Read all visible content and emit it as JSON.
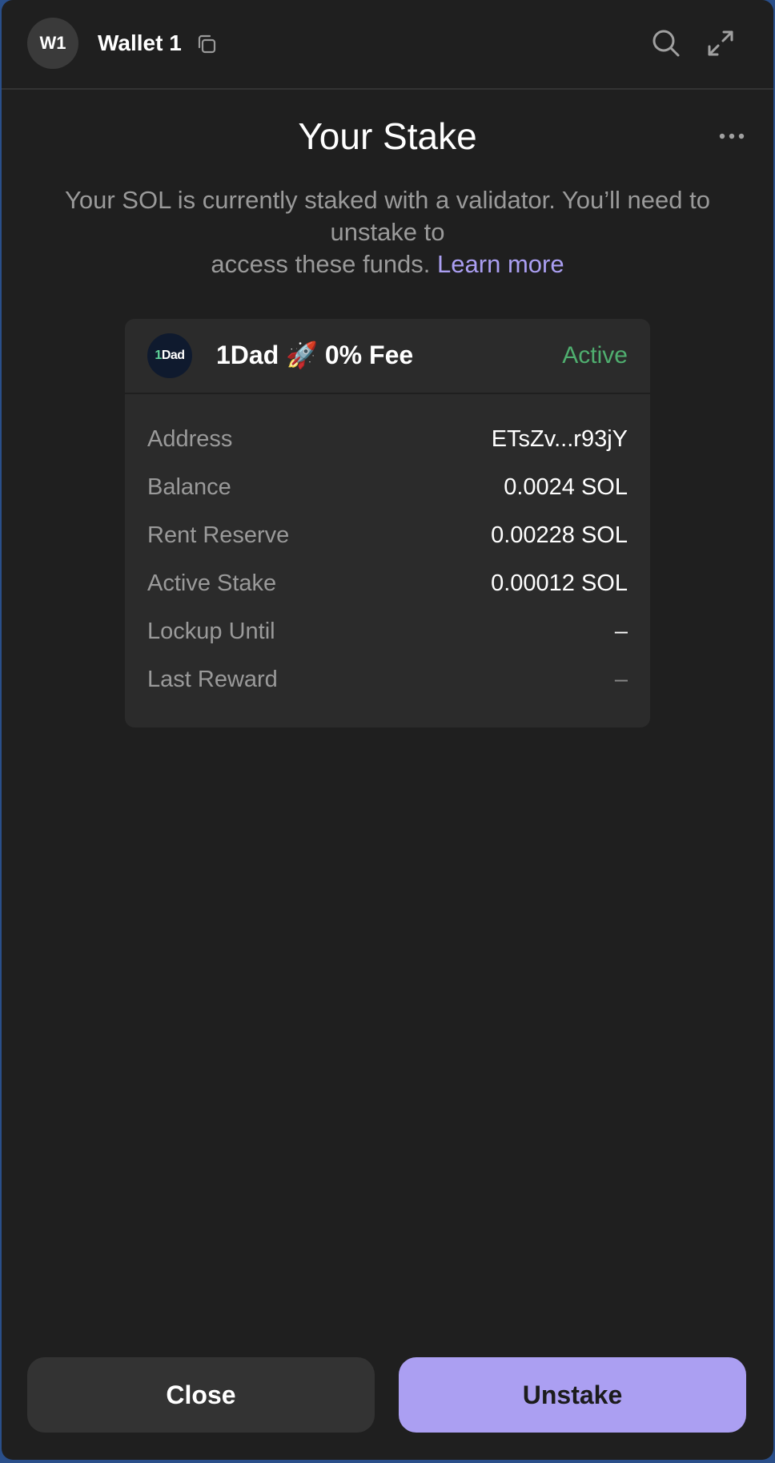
{
  "header": {
    "avatar_initials": "W1",
    "wallet_name": "Wallet 1",
    "icons": [
      "copy-icon",
      "search-icon",
      "expand-icon"
    ]
  },
  "page": {
    "title": "Your Stake",
    "more_icon": "more-icon",
    "description_line1": "Your SOL is currently staked with a validator. You’ll need to unstake to",
    "description_line2": "access these funds.",
    "learn_more": "Learn more"
  },
  "validator": {
    "logo_text_one": "1",
    "logo_text_rest": "Dad",
    "name": "1Dad 🚀 0% Fee",
    "status": "Active",
    "status_color": "#4fae6f"
  },
  "details": [
    {
      "label": "Address",
      "value": "ETsZv...r93jY"
    },
    {
      "label": "Balance",
      "value": "0.0024 SOL"
    },
    {
      "label": "Rent Reserve",
      "value": "0.00228 SOL"
    },
    {
      "label": "Active Stake",
      "value": "0.00012 SOL"
    },
    {
      "label": "Lockup Until",
      "value": "–"
    },
    {
      "label": "Last Reward",
      "value": "–"
    }
  ],
  "buttons": {
    "close": "Close",
    "unstake": "Unstake",
    "accent_color": "#ab9ff2"
  }
}
